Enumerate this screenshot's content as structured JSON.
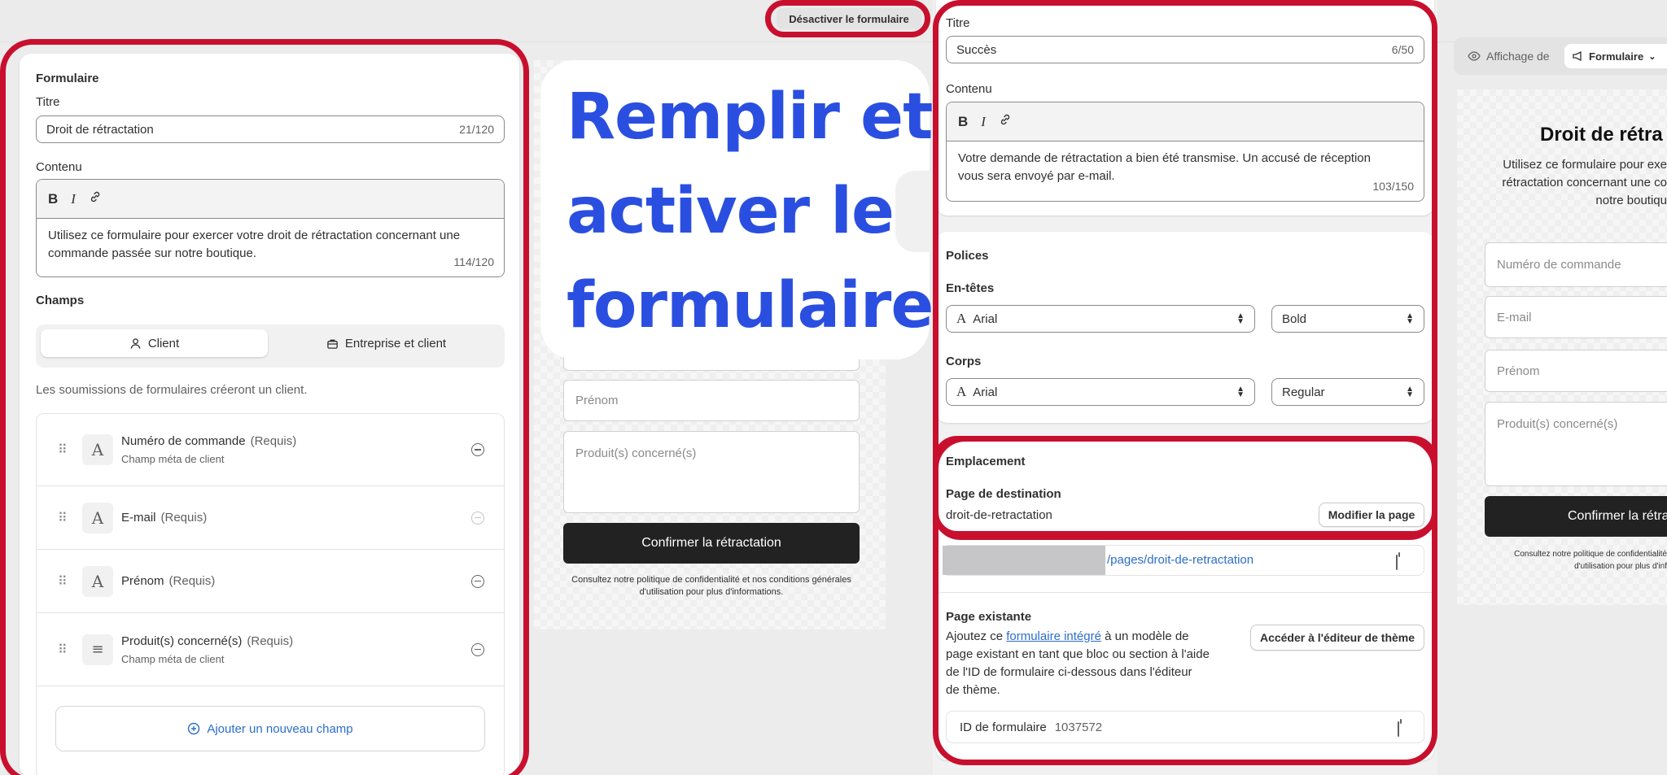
{
  "topbar": {
    "deactivate_label": "Désactiver le formulaire"
  },
  "headline": {
    "line1": "Remplir et",
    "line2": "activer le",
    "line3": "formulaire"
  },
  "form_panel": {
    "section_title": "Formulaire",
    "title_label": "Titre",
    "title_value": "Droit de rétractation",
    "title_counter": "21/120",
    "content_label": "Contenu",
    "content_value": "Utilisez ce formulaire pour exercer votre droit de rétractation concernant une commande passée sur notre boutique.",
    "content_counter": "114/120",
    "toolbar": {
      "bold": "B",
      "italic": "I"
    },
    "fields_title": "Champs",
    "tabs": [
      {
        "label": "Client"
      },
      {
        "label": "Entreprise et client"
      }
    ],
    "info_text": "Les soumissions de formulaires créeront un client.",
    "fields": [
      {
        "name": "Numéro de commande",
        "required": "(Requis)",
        "subtitle": "Champ méta de client",
        "type_glyph": "A"
      },
      {
        "name": "E-mail",
        "required": "(Requis)",
        "type_glyph": "A"
      },
      {
        "name": "Prénom",
        "required": "(Requis)",
        "type_glyph": "A"
      },
      {
        "name": "Produit(s) concerné(s)",
        "required": "(Requis)",
        "subtitle": "Champ méta de client",
        "type_glyph": "≡"
      }
    ],
    "add_field_label": "Ajouter un nouveau champ"
  },
  "preview_mid": {
    "firstname_placeholder": "Prénom",
    "products_placeholder": "Produit(s) concerné(s)",
    "confirm_label": "Confirmer la rétractation",
    "footnote_line1": "Consultez notre politique de confidentialité et nos conditions générales",
    "footnote_line2": "d'utilisation pour plus d'informations."
  },
  "success_panel": {
    "title_label": "Titre",
    "title_value": "Succès",
    "title_counter": "6/50",
    "content_label": "Contenu",
    "content_value": "Votre demande de rétractation a bien été transmise. Un accusé de réception vous sera envoyé par e-mail.",
    "content_counter": "103/150"
  },
  "fonts_panel": {
    "title": "Polices",
    "headings_label": "En-têtes",
    "headings_font": "Arial",
    "headings_weight": "Bold",
    "body_label": "Corps",
    "body_font": "Arial",
    "body_weight": "Regular"
  },
  "placement_panel": {
    "title": "Emplacement",
    "dest_label": "Page de destination",
    "dest_value": "droit-de-retractation",
    "edit_page_label": "Modifier la page",
    "url_path": "/pages/droit-de-retractation",
    "existing_label": "Page existante",
    "existing_text_before": "Ajoutez ce ",
    "existing_link": "formulaire intégré",
    "existing_text_after1": " à un modèle de",
    "existing_text_line2": "page existant en tant que bloc ou section à l'aide",
    "existing_text_line3": "de l'ID de formulaire ci-dessous dans l'éditeur",
    "existing_text_line4": "de thème.",
    "theme_editor_label": "Accéder à l'éditeur de thème",
    "form_id_label": "ID de formulaire",
    "form_id_value": "1037572"
  },
  "preview_right": {
    "view_label": "Affichage de",
    "view_select": "Formulaire",
    "heading": "Droit de rétra",
    "desc_line1": "Utilisez ce formulaire pour exe",
    "desc_line2": "rétractation concernant une co",
    "desc_line3": "notre boutiqu",
    "order_placeholder": "Numéro de commande",
    "email_placeholder": "E-mail",
    "firstname_placeholder": "Prénom",
    "products_placeholder": "Produit(s) concerné(s)",
    "confirm_label": "Confirmer la rétra",
    "footnote_line1": "Consultez notre politique de confidentialité",
    "footnote_line2": "d'utilisation pour plus d'inf"
  },
  "colors": {
    "annotation_red": "#c8102e",
    "headline_blue": "#2a4fe0",
    "link_blue": "#2c6ecb",
    "primary_dark": "#222222"
  }
}
